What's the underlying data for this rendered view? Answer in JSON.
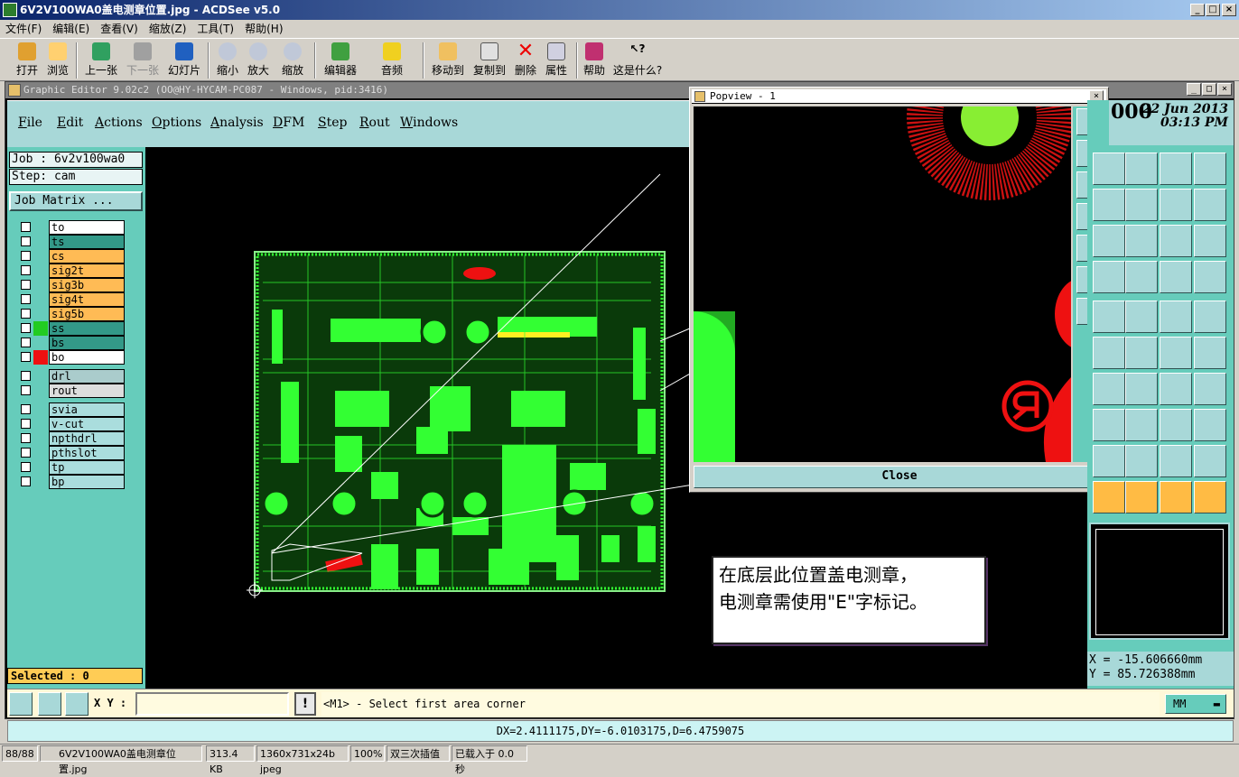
{
  "window": {
    "title": "6V2V100WA0盖电测章位置.jpg - ACDSee v5.0"
  },
  "menu": [
    "文件(F)",
    "编辑(E)",
    "查看(V)",
    "缩放(Z)",
    "工具(T)",
    "帮助(H)"
  ],
  "toolbar": [
    {
      "label": "打开",
      "icon": "open-icon"
    },
    {
      "label": "浏览",
      "icon": "browse-icon"
    },
    {
      "label": "上一张",
      "icon": "prev-icon"
    },
    {
      "label": "下一张",
      "icon": "next-icon"
    },
    {
      "label": "幻灯片",
      "icon": "slideshow-icon"
    },
    {
      "label": "缩小",
      "icon": "zoom-out-icon"
    },
    {
      "label": "放大",
      "icon": "zoom-in-icon"
    },
    {
      "label": "缩放",
      "icon": "zoom-icon"
    },
    {
      "label": "编辑器",
      "icon": "editor-icon"
    },
    {
      "label": "音频",
      "icon": "audio-icon"
    },
    {
      "label": "移动到",
      "icon": "move-icon"
    },
    {
      "label": "复制到",
      "icon": "copy-icon"
    },
    {
      "label": "删除",
      "icon": "delete-icon"
    },
    {
      "label": "属性",
      "icon": "properties-icon"
    },
    {
      "label": "帮助",
      "icon": "help-icon"
    },
    {
      "label": "这是什么?",
      "icon": "whats-this-icon"
    }
  ],
  "editor": {
    "title": "Graphic Editor 9.02c2 (OO@HY-HYCAM-PC087 - Windows, pid:3416)",
    "menu": [
      "File",
      "Edit",
      "Actions",
      "Options",
      "Analysis",
      "DFM",
      "Step",
      "Rout",
      "Windows"
    ],
    "job": "Job : 6v2v100wa0",
    "step": "Step: cam",
    "job_matrix": "Job Matrix ...",
    "selected": "Selected : 0",
    "date_partial": "000",
    "date": "22 Jun 2013",
    "time": "03:13 PM",
    "coord_x": "X = -15.606660mm",
    "coord_y": "Y = 85.726388mm",
    "prompt": "<M1> - Select first area corner",
    "xy_label": "X Y :",
    "xy_value": "",
    "exclamation": "!",
    "units": "MM",
    "measure": "DX=2.4111175,DY=-6.0103175,D=6.4759075"
  },
  "layers": [
    {
      "name": "to",
      "bg": "#ffffff"
    },
    {
      "name": "ts",
      "bg": "#339988"
    },
    {
      "name": "cs",
      "bg": "#ffbb55"
    },
    {
      "name": "sig2t",
      "bg": "#ffbb55"
    },
    {
      "name": "sig3b",
      "bg": "#ffbb55"
    },
    {
      "name": "sig4t",
      "bg": "#ffbb55"
    },
    {
      "name": "sig5b",
      "bg": "#ffbb55"
    },
    {
      "name": "ss",
      "bg": "#339988",
      "swatch": "#22cc22"
    },
    {
      "name": "bs",
      "bg": "#339988"
    },
    {
      "name": "bo",
      "bg": "#ffffff",
      "swatch": "#ee1111"
    },
    {
      "name": "drl",
      "bg": "#aacccc"
    },
    {
      "name": "rout",
      "bg": "#dddddd"
    },
    {
      "name": "svia",
      "bg": "#aadddd"
    },
    {
      "name": "v-cut",
      "bg": "#aadddd"
    },
    {
      "name": "npthdrl",
      "bg": "#aadddd"
    },
    {
      "name": "pthslot",
      "bg": "#aadddd"
    },
    {
      "name": "tp",
      "bg": "#aadddd"
    },
    {
      "name": "bp",
      "bg": "#aadddd"
    }
  ],
  "popview": {
    "title": "Popview - 1",
    "close": "Close"
  },
  "annotation": {
    "line1": "在底层此位置盖电测章，",
    "line2": "电测章需使用\"E\"字标记。"
  },
  "status": [
    "88/88",
    "6V2V100WA0盖电测章位置.jpg",
    "313.4 KB",
    "1360x731x24b jpeg",
    "100%",
    "双三次插值",
    "已载入于 0.0 秒"
  ],
  "colors": {
    "pcb_green": "#33ff33",
    "pcb_dark": "#0a4a0a",
    "panel_teal": "#66ccbb",
    "copper_red": "#ee1111"
  }
}
